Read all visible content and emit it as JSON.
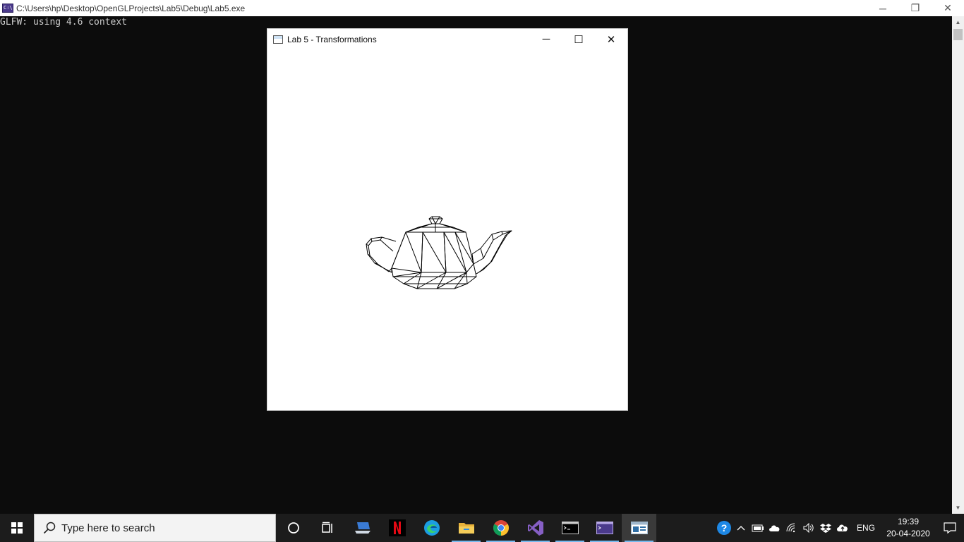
{
  "console": {
    "title": "C:\\Users\\hp\\Desktop\\OpenGLProjects\\Lab5\\Debug\\Lab5.exe",
    "output": "GLFW: using 4.6 context",
    "controls": {
      "minimize": "─",
      "restore": "❐",
      "close": "✕"
    }
  },
  "gl_window": {
    "title": "Lab 5 - Transformations",
    "controls": {
      "minimize": "─",
      "maximize": "☐",
      "close": "✕"
    }
  },
  "taskbar": {
    "search_placeholder": "Type here to search",
    "apps": [
      "cortana-icon",
      "task-view-icon",
      "laptop-app-icon",
      "netflix-icon",
      "edge-icon",
      "file-explorer-icon",
      "chrome-icon",
      "visual-studio-icon",
      "terminal-icon",
      "console-app-icon",
      "gl-app-icon"
    ],
    "tray": {
      "language": "ENG",
      "time": "19:39",
      "date": "20-04-2020"
    }
  },
  "colors": {
    "console_bg": "#0c0c0c",
    "console_text": "#cccccc",
    "taskbar_bg": "#1c1c1c",
    "accent": "#76b9ed"
  }
}
